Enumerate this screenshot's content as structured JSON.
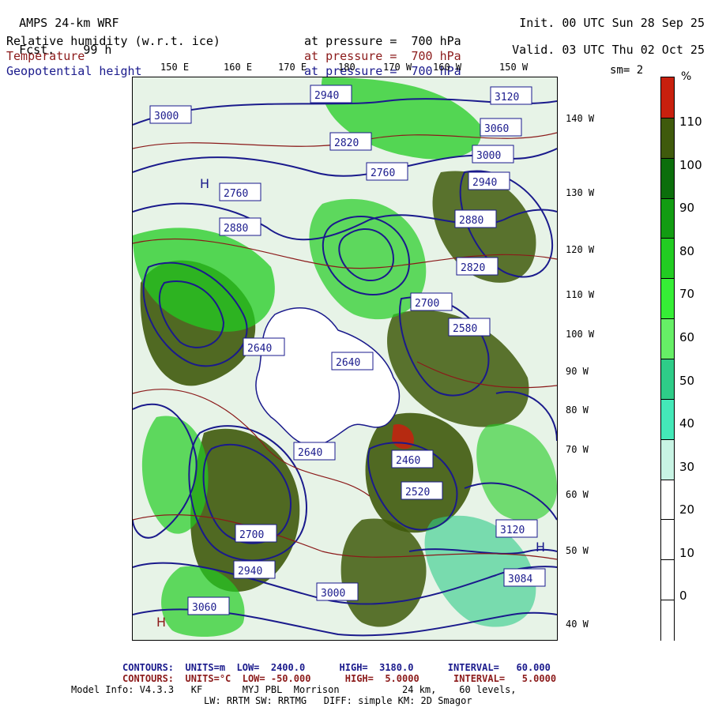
{
  "header": {
    "model": "AMPS 24-km WRF",
    "fcst_label": "Fcst.",
    "fcst_value": "99 h",
    "init": "Init. 00 UTC Sun 28 Sep 25",
    "valid": "Valid. 03 UTC Thu 02 Oct 25"
  },
  "fields": [
    {
      "name": "Relative humidity (w.r.t. ice)",
      "level": "at pressure =  700 hPa",
      "color": "#000000"
    },
    {
      "name": "Temperature",
      "level": "at pressure =  700 hPa",
      "color": "#8b1a1a"
    },
    {
      "name": "Geopotential height",
      "level": "at pressure =  700 hPa",
      "color": "#1a1a8c"
    }
  ],
  "smoothing": "sm= 2",
  "lon_labels_top": [
    "150 E",
    "160 E",
    "170 E",
    "180",
    "170 W",
    "160 W",
    "150 W"
  ],
  "lat_labels_right": [
    "140 W",
    "130 W",
    "120 W",
    "110 W",
    "100 W",
    "90 W",
    "80 W",
    "70 W",
    "60 W",
    "50 W",
    "40 W"
  ],
  "colorbar": {
    "unit": "%",
    "labels": [
      "110",
      "100",
      "90",
      "80",
      "70",
      "60",
      "50",
      "40",
      "30",
      "20",
      "10",
      "0"
    ],
    "colors": [
      "#c8200e",
      "#3f5a0c",
      "#0b6e0b",
      "#129c12",
      "#22cc22",
      "#36ee36",
      "#66ef66",
      "#2ecc88",
      "#44e8b8",
      "#c8f4e4",
      "#ffffff",
      "#ffffff",
      "#ffffff",
      "#ffffff"
    ]
  },
  "contour_labels": [
    "3120",
    "3060",
    "3000",
    "2940",
    "2880",
    "2820",
    "2760",
    "2700",
    "2640",
    "2580",
    "2520",
    "2460",
    "2940",
    "3000",
    "3060",
    "3120",
    "3084",
    "2640",
    "2640",
    "2700",
    "2760",
    "2880",
    "3000",
    "2940",
    "2820"
  ],
  "footer": {
    "line1": "CONTOURS:  UNITS=m  LOW=  2400.0      HIGH=  3180.0      INTERVAL=   60.000",
    "line2": "CONTOURS:  UNITS=°C  LOW= -50.000      HIGH=  5.0000      INTERVAL=   5.0000",
    "line3": "Model Info: V4.3.3   KF       MYJ PBL  Morrison           24 km,    60 levels,",
    "line4": "LW: RRTM SW: RRTMG   DIFF: simple KM: 2D Smagor"
  }
}
